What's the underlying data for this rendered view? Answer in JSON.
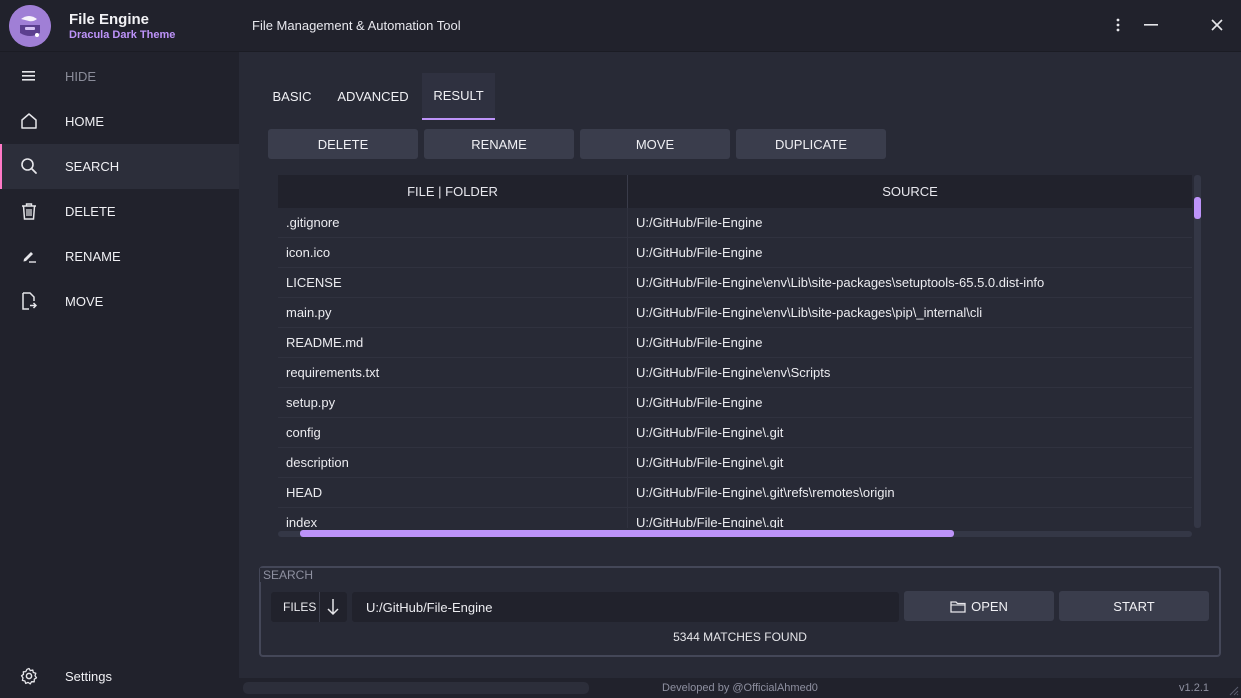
{
  "app": {
    "title": "File Engine",
    "subtitle": "Dracula Dark Theme",
    "description": "File Management & Automation Tool"
  },
  "window_controls": [
    "more-icon",
    "minimize-icon",
    "close-icon"
  ],
  "sidebar": {
    "toggle_label": "HIDE",
    "items": [
      {
        "label": "HOME",
        "icon": "home-icon",
        "active": false
      },
      {
        "label": "SEARCH",
        "icon": "search-icon",
        "active": true
      },
      {
        "label": "DELETE",
        "icon": "trash-icon",
        "active": false
      },
      {
        "label": "RENAME",
        "icon": "rename-icon",
        "active": false
      },
      {
        "label": "MOVE",
        "icon": "move-file-icon",
        "active": false
      }
    ],
    "settings_label": "Settings"
  },
  "tabs": [
    "BASIC",
    "ADVANCED",
    "RESULT"
  ],
  "active_tab": "RESULT",
  "actions": [
    "DELETE",
    "RENAME",
    "MOVE",
    "DUPLICATE"
  ],
  "table": {
    "headers": [
      "FILE | FOLDER",
      "SOURCE"
    ],
    "rows": [
      [
        ".gitignore",
        "U:/GitHub/File-Engine"
      ],
      [
        "icon.ico",
        "U:/GitHub/File-Engine"
      ],
      [
        "LICENSE",
        "U:/GitHub/File-Engine\\env\\Lib\\site-packages\\setuptools-65.5.0.dist-info"
      ],
      [
        "main.py",
        "U:/GitHub/File-Engine\\env\\Lib\\site-packages\\pip\\_internal\\cli"
      ],
      [
        "README.md",
        "U:/GitHub/File-Engine"
      ],
      [
        "requirements.txt",
        "U:/GitHub/File-Engine\\env\\Scripts"
      ],
      [
        "setup.py",
        "U:/GitHub/File-Engine"
      ],
      [
        "config",
        "U:/GitHub/File-Engine\\.git"
      ],
      [
        "description",
        "U:/GitHub/File-Engine\\.git"
      ],
      [
        "HEAD",
        "U:/GitHub/File-Engine\\.git\\refs\\remotes\\origin"
      ],
      [
        "index",
        "U:/GitHub/File-Engine\\.git"
      ]
    ]
  },
  "search": {
    "group_label": "SEARCH",
    "mode_label": "FILES",
    "path_value": "U:/GitHub/File-Engine",
    "open_label": "OPEN",
    "start_label": "START",
    "matches_text": "5344 MATCHES FOUND"
  },
  "footer": {
    "credit": "Developed by @OfficialAhmed0",
    "version": "v1.2.1"
  },
  "colors": {
    "accent": "#bd93f9",
    "active_indicator": "#ff79c6",
    "background": "#282a36",
    "panel": "#21222c"
  }
}
